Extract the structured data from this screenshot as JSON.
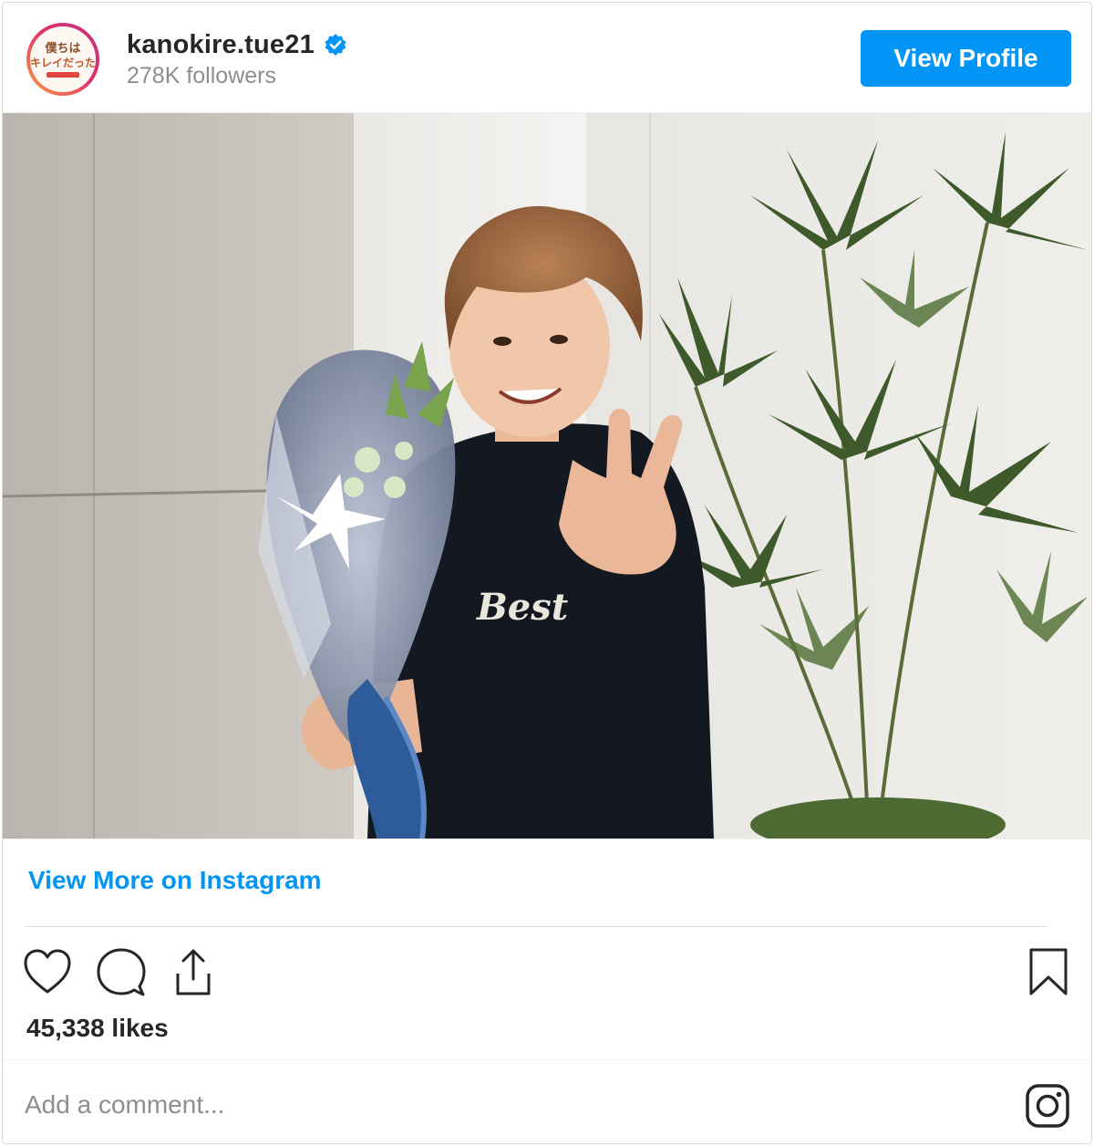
{
  "header": {
    "username": "kanokire.tue21",
    "followers": "278K followers",
    "view_profile_label": "View Profile",
    "verified_icon": "verified-badge-icon",
    "avatar_icon": "profile-avatar"
  },
  "photo": {
    "icon": "post-photo"
  },
  "link": {
    "view_more_label": "View More on Instagram"
  },
  "actions": {
    "like_icon": "heart-icon",
    "comment_icon": "comment-icon",
    "share_icon": "share-icon",
    "save_icon": "bookmark-icon"
  },
  "likes": {
    "text": "45,338 likes"
  },
  "comment": {
    "placeholder": "Add a comment...",
    "brand_icon": "instagram-icon"
  },
  "colors": {
    "accent": "#0095f6",
    "text": "#262626",
    "muted": "#8e8e8e",
    "border": "#dbdbdb"
  }
}
